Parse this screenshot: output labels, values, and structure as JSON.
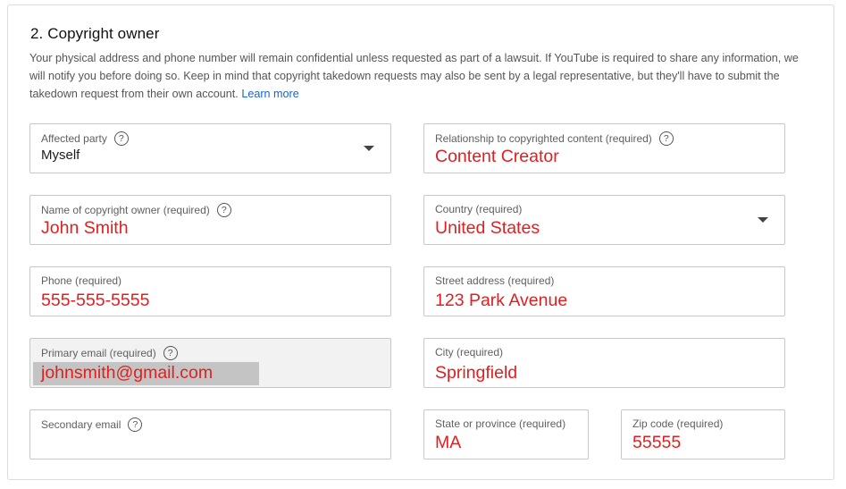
{
  "section": {
    "title": "2. Copyright owner",
    "description": "Your physical address and phone number will remain confidential unless requested as part of a lawsuit. If YouTube is required to share any information, we will notify you before doing so. Keep in mind that copyright takedown requests may also be sent by a legal representative, but they'll have to submit the takedown request from their own account.",
    "learn_more": "Learn more"
  },
  "fields": {
    "affected_party": {
      "label": "Affected party",
      "value": "Myself"
    },
    "relationship": {
      "label": "Relationship to copyrighted content (required)",
      "value": "Content Creator"
    },
    "owner_name": {
      "label": "Name of copyright owner (required)",
      "value": "John Smith"
    },
    "country": {
      "label": "Country (required)",
      "value": "United States"
    },
    "phone": {
      "label": "Phone (required)",
      "value": "555-555-5555"
    },
    "street": {
      "label": "Street address (required)",
      "value": "123 Park Avenue"
    },
    "primary_email": {
      "label": "Primary email (required)",
      "value": "johnsmith@gmail.com"
    },
    "city": {
      "label": "City (required)",
      "value": "Springfield"
    },
    "secondary_email": {
      "label": "Secondary email",
      "value": ""
    },
    "state": {
      "label": "State or province (required)",
      "value": "MA"
    },
    "zip": {
      "label": "Zip code (required)",
      "value": "55555"
    }
  },
  "help_glyph": "?",
  "colors": {
    "entered_value": "#e02020",
    "link": "#1a64c8"
  }
}
